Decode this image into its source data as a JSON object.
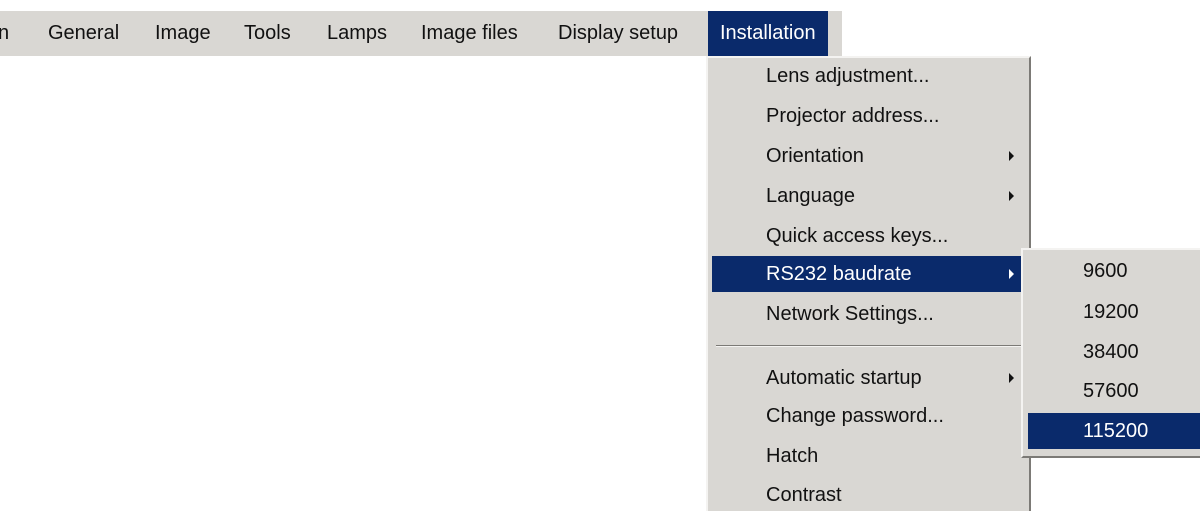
{
  "menubar": {
    "items": [
      {
        "label": "n"
      },
      {
        "label": "General"
      },
      {
        "label": "Image"
      },
      {
        "label": "Tools"
      },
      {
        "label": "Lamps"
      },
      {
        "label": "Image files"
      },
      {
        "label": "Display setup"
      },
      {
        "label": "Installation",
        "active": true
      }
    ]
  },
  "installation_menu": {
    "items": [
      {
        "label": "Lens adjustment..."
      },
      {
        "label": "Projector address..."
      },
      {
        "label": "Orientation",
        "submenu": true
      },
      {
        "label": "Language",
        "submenu": true
      },
      {
        "label": "Quick access keys..."
      },
      {
        "label": "RS232 baudrate",
        "submenu": true,
        "selected": true
      },
      {
        "label": "Network Settings..."
      },
      {
        "label": "Automatic startup",
        "submenu": true
      },
      {
        "label": "Change password..."
      },
      {
        "label": "Hatch"
      },
      {
        "label": "Contrast"
      }
    ]
  },
  "baudrate_submenu": {
    "items": [
      {
        "label": "9600"
      },
      {
        "label": "19200"
      },
      {
        "label": "38400"
      },
      {
        "label": "57600"
      },
      {
        "label": "115200",
        "selected": true
      }
    ]
  },
  "colors": {
    "menu_background": "#d9d7d3",
    "selection": "#0a2a6b",
    "selection_text": "#ffffff"
  }
}
